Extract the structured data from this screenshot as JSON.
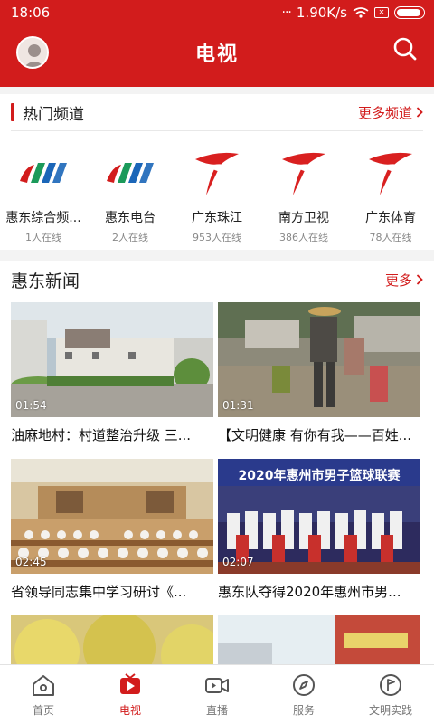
{
  "status_bar": {
    "time": "18:06",
    "speed": "1.90K/s",
    "signal_dots": "···",
    "sim_label": "✕"
  },
  "header": {
    "title": "电视"
  },
  "hot_channels": {
    "title": "热门频道",
    "more": "更多频道",
    "items": [
      {
        "name": "惠东综合频...",
        "online": "1人在线",
        "logo": "huidong-logo"
      },
      {
        "name": "惠东电台",
        "online": "2人在线",
        "logo": "huidong-logo"
      },
      {
        "name": "广东珠江",
        "online": "953人在线",
        "logo": "guangdong-tv-logo"
      },
      {
        "name": "南方卫视",
        "online": "386人在线",
        "logo": "guangdong-tv-logo"
      },
      {
        "name": "广东体育",
        "online": "78人在线",
        "logo": "guangdong-tv-logo"
      }
    ]
  },
  "news": {
    "title": "惠东新闻",
    "more": "更多",
    "items": [
      {
        "title": "油麻地村：村道整治升级 三...",
        "duration": "01:54"
      },
      {
        "title": "【文明健康 有你有我——百姓...",
        "duration": "01:31"
      },
      {
        "title": "省领导同志集中学习研讨《...",
        "duration": "02:45"
      },
      {
        "title": "惠东队夺得2020年惠州市男...",
        "duration": "02:07",
        "banner": "2020年惠州市男子篮球联赛"
      }
    ]
  },
  "bottom_nav": [
    {
      "label": "首页",
      "icon": "home-icon"
    },
    {
      "label": "电视",
      "icon": "tv-icon"
    },
    {
      "label": "直播",
      "icon": "live-camera-icon"
    },
    {
      "label": "服务",
      "icon": "compass-icon"
    },
    {
      "label": "文明实践",
      "icon": "flag-icon"
    }
  ],
  "colors": {
    "brand": "#d21c1c",
    "text": "#222222",
    "muted": "#888888"
  }
}
